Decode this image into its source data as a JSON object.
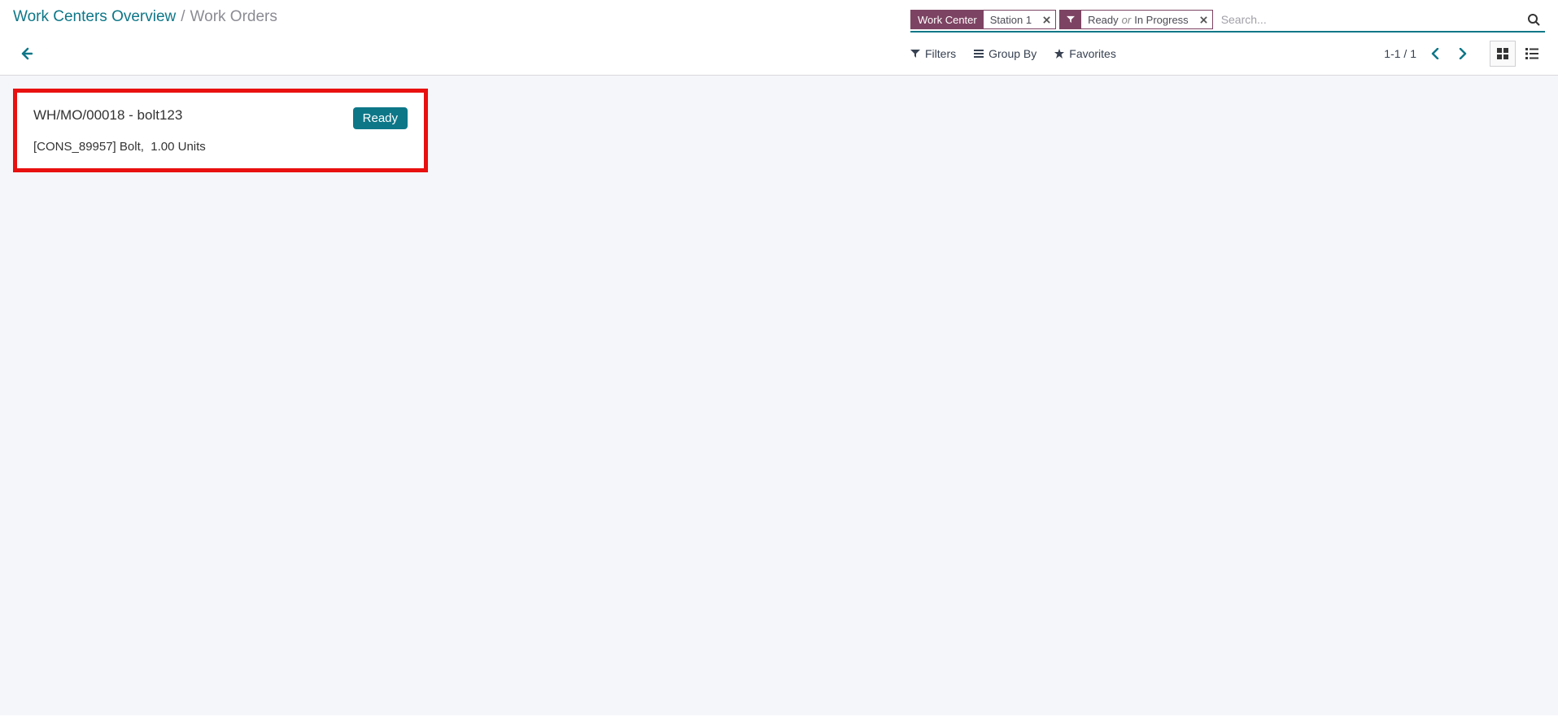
{
  "breadcrumb": {
    "parent": "Work Centers Overview",
    "separator": "/",
    "current": "Work Orders"
  },
  "search": {
    "placeholder": "Search...",
    "facet1_label": "Work Center",
    "facet1_value": "Station 1",
    "facet2_icon": "filter",
    "facet2_v1": "Ready",
    "facet2_or": "or",
    "facet2_v2": "In Progress"
  },
  "toolbar": {
    "filters": "Filters",
    "group_by": "Group By",
    "favorites": "Favorites",
    "page_count": "1-1 / 1"
  },
  "card": {
    "title": "WH/MO/00018 - bolt123",
    "status": "Ready",
    "subtitle": "[CONS_89957] Bolt,  1.00 Units"
  }
}
